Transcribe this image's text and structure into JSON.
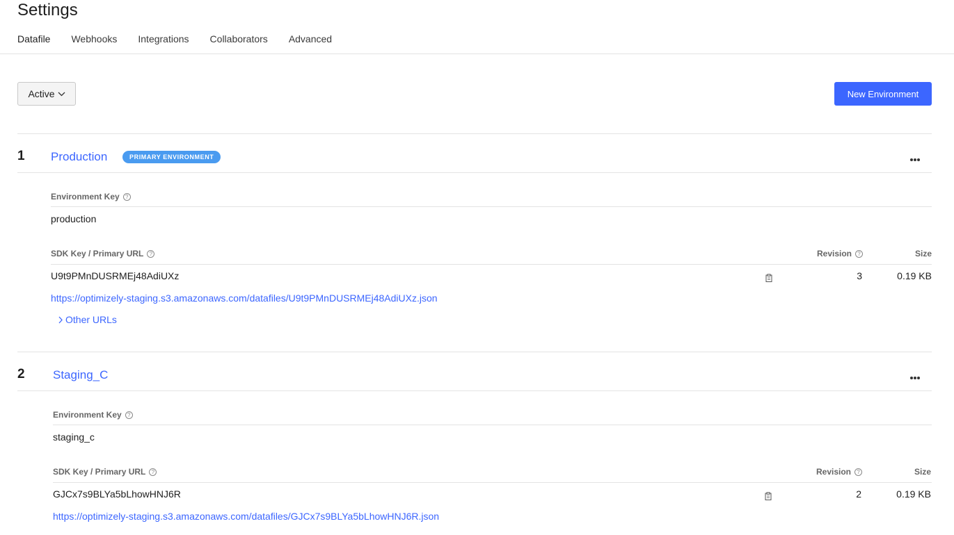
{
  "page": {
    "title": "Settings"
  },
  "tabs": [
    {
      "label": "Datafile",
      "active": true
    },
    {
      "label": "Webhooks",
      "active": false
    },
    {
      "label": "Integrations",
      "active": false
    },
    {
      "label": "Collaborators",
      "active": false
    },
    {
      "label": "Advanced",
      "active": false
    }
  ],
  "toolbar": {
    "filter_label": "Active",
    "new_environment_label": "New Environment"
  },
  "columns": {
    "environment_key": "Environment Key",
    "sdk_key": "SDK Key / Primary URL",
    "revision": "Revision",
    "size": "Size",
    "help_glyph": "?"
  },
  "environments": [
    {
      "number": "1",
      "name": "Production",
      "badge": "PRIMARY ENVIRONMENT",
      "key": "production",
      "sdk_key": "U9t9PMnDUSRMEj48AdiUXz",
      "url": "https://optimizely-staging.s3.amazonaws.com/datafiles/U9t9PMnDUSRMEj48AdiUXz.json",
      "other_urls_label": "Other URLs",
      "revision": "3",
      "size": "0.19 KB"
    },
    {
      "number": "2",
      "name": "Staging_C",
      "key": "staging_c",
      "sdk_key": "GJCx7s9BLYa5bLhowHNJ6R",
      "url": "https://optimizely-staging.s3.amazonaws.com/datafiles/GJCx7s9BLYa5bLhowHNJ6R.json",
      "revision": "2",
      "size": "0.19 KB"
    }
  ],
  "icons": {
    "more": "more-horizontal-icon",
    "copy": "clipboard-icon",
    "chevron_down": "chevron-down-icon",
    "chevron_right": "chevron-right-icon",
    "help": "help-circle-icon"
  },
  "colors": {
    "accent": "#3c66ff",
    "badge": "#4a9bf0",
    "divider": "#e3e3e3"
  }
}
